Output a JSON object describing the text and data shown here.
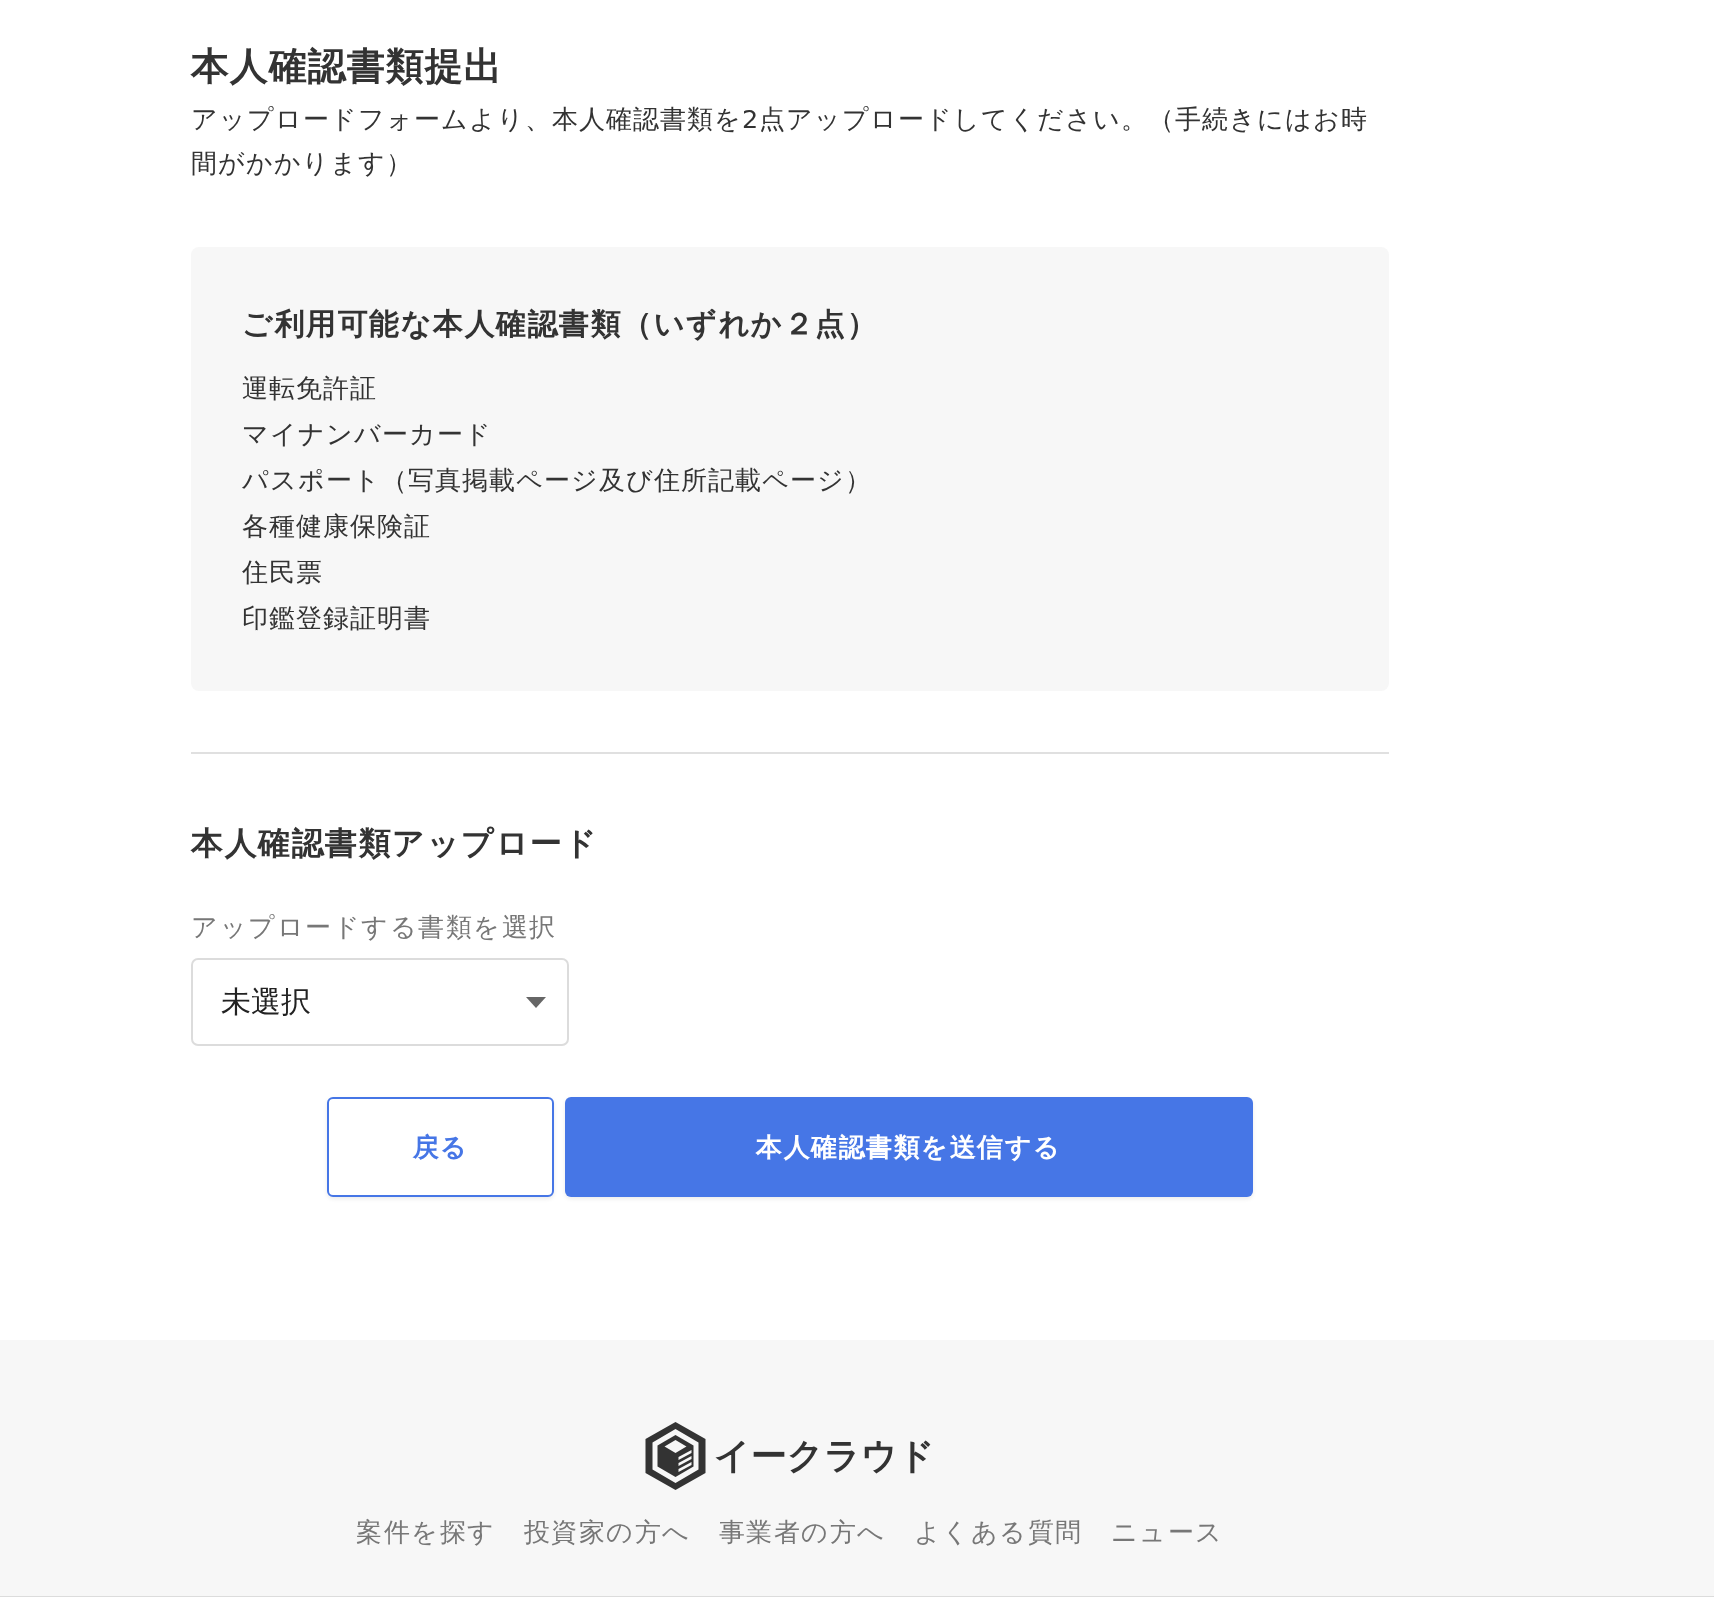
{
  "page": {
    "title": "本人確認書類提出",
    "description": "アップロードフォームより、本人確認書類を2点アップロードしてください。（手続きにはお時間がかかります）"
  },
  "documents_panel": {
    "title": "ご利用可能な本人確認書類（いずれか２点）",
    "items": [
      "運転免許証",
      "マイナンバーカード",
      "パスポート（写真掲載ページ及び住所記載ページ）",
      "各種健康保険証",
      "住民票",
      "印鑑登録証明書"
    ]
  },
  "upload": {
    "title": "本人確認書類アップロード",
    "select": {
      "label": "アップロードする書類を選択",
      "value": "未選択"
    }
  },
  "buttons": [
    {
      "label": "戻る",
      "kind": "secondary"
    },
    {
      "label": "本人確認書類を送信する",
      "kind": "primary"
    }
  ],
  "footer": {
    "logo_text": "イークラウド",
    "nav": [
      "案件を探す",
      "投資家の方へ",
      "事業者の方へ",
      "よくある質問",
      "ニュース"
    ]
  }
}
